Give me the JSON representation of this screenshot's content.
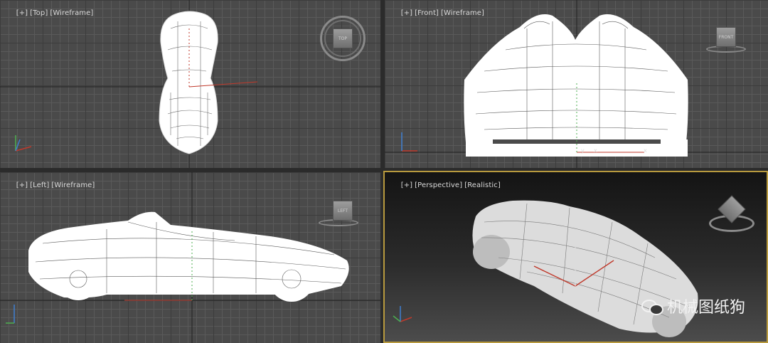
{
  "viewports": {
    "top": {
      "bracket": "[+]",
      "view": "[Top]",
      "shading": "[Wireframe]",
      "cube_label": "TOP"
    },
    "front": {
      "bracket": "[+]",
      "view": "[Front]",
      "shading": "[Wireframe]",
      "cube_label": "FRONT"
    },
    "left": {
      "bracket": "[+]",
      "view": "[Left]",
      "shading": "[Wireframe]",
      "cube_label": "LEFT"
    },
    "persp": {
      "bracket": "[+]",
      "view": "[Perspective]",
      "shading": "[Realistic]"
    }
  },
  "gizmo_labels": {
    "x": "x",
    "y": "y",
    "z": "z"
  },
  "watermark": "机械图纸狗",
  "colors": {
    "grid_bg": "#4a4a4a",
    "active_border": "#b89a3e",
    "wire": "#ffffff",
    "axis_x": "#c0392b",
    "axis_y": "#4caf50",
    "axis_z": "#3f7fd1"
  }
}
